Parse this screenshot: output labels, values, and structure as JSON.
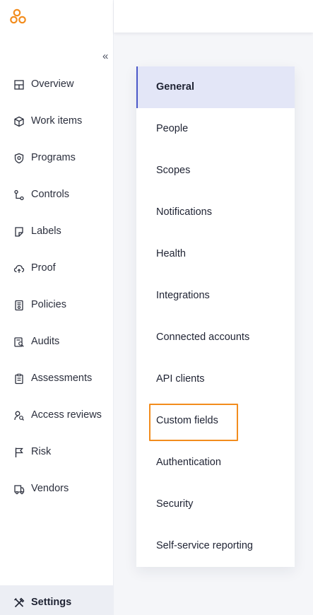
{
  "colors": {
    "brand": "#f28c1d",
    "active_bg": "#e3e6f7",
    "active_border": "#4b58c8",
    "highlight": "#f28c1d"
  },
  "sidebar": {
    "collapse_glyph": "«",
    "items": [
      {
        "label": "Overview",
        "icon": "layout-icon"
      },
      {
        "label": "Work items",
        "icon": "package-icon"
      },
      {
        "label": "Programs",
        "icon": "shield-icon"
      },
      {
        "label": "Controls",
        "icon": "flow-icon"
      },
      {
        "label": "Labels",
        "icon": "tag-icon"
      },
      {
        "label": "Proof",
        "icon": "cloud-icon"
      },
      {
        "label": "Policies",
        "icon": "policy-document-icon"
      },
      {
        "label": "Audits",
        "icon": "audit-search-icon"
      },
      {
        "label": "Assessments",
        "icon": "clipboard-icon"
      },
      {
        "label": "Access reviews",
        "icon": "user-review-icon"
      },
      {
        "label": "Risk",
        "icon": "flag-icon"
      },
      {
        "label": "Vendors",
        "icon": "truck-icon"
      }
    ],
    "settings_label": "Settings"
  },
  "settings_menu": {
    "active": "General",
    "items": [
      "General",
      "People",
      "Scopes",
      "Notifications",
      "Health",
      "Integrations",
      "Connected accounts",
      "API clients",
      "Custom fields",
      "Authentication",
      "Security",
      "Self-service reporting"
    ]
  }
}
